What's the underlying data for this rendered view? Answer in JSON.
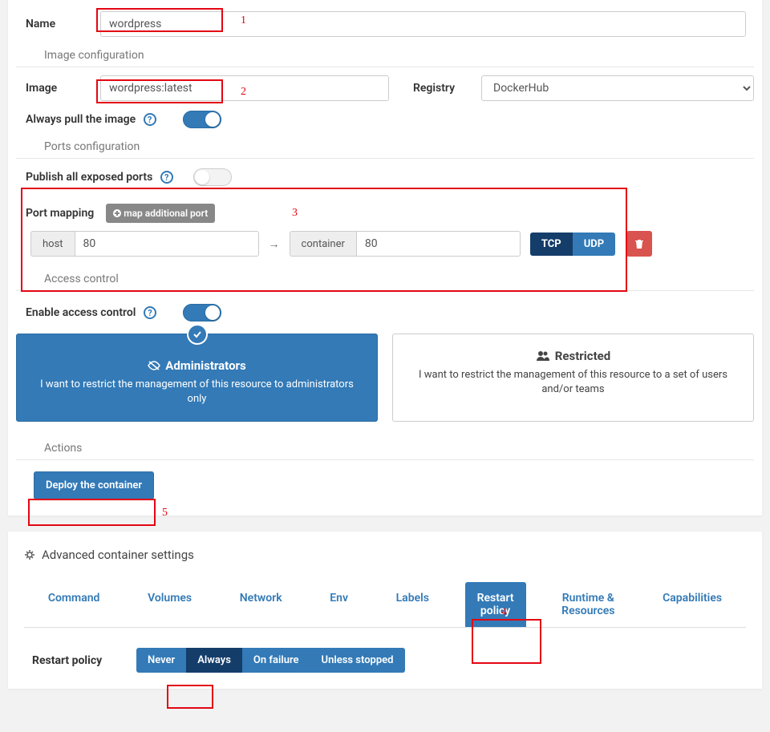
{
  "name": {
    "label": "Name",
    "value": "wordpress"
  },
  "sections": {
    "image_config": "Image configuration",
    "ports_config": "Ports configuration",
    "access_control": "Access control",
    "actions": "Actions"
  },
  "image": {
    "label": "Image",
    "value": "wordpress:latest",
    "registry_label": "Registry",
    "registry_value": "DockerHub",
    "always_pull_label": "Always pull the image"
  },
  "ports": {
    "publish_all_label": "Publish all exposed ports",
    "mapping_label": "Port mapping",
    "add_btn": "map additional port",
    "host_addon": "host",
    "host_value": "80",
    "container_addon": "container",
    "container_value": "80",
    "tcp": "TCP",
    "udp": "UDP"
  },
  "access": {
    "enable_label": "Enable access control",
    "admin_title": "Administrators",
    "admin_desc": "I want to restrict the management of this resource to administrators only",
    "restricted_title": "Restricted",
    "restricted_desc": "I want to restrict the management of this resource to a set of users and/or teams"
  },
  "actions": {
    "deploy": "Deploy the container"
  },
  "annotations": {
    "n1": "1",
    "n2": "2",
    "n3": "3",
    "n4": "4",
    "n5": "5"
  },
  "advanced": {
    "title": "Advanced container settings",
    "tabs": [
      "Command",
      "Volumes",
      "Network",
      "Env",
      "Labels",
      "Restart\npolicy",
      "Runtime &\nResources",
      "Capabilities"
    ],
    "active_tab": 5,
    "restart_label": "Restart policy",
    "restart_options": [
      "Never",
      "Always",
      "On failure",
      "Unless stopped"
    ],
    "restart_active": 1
  }
}
